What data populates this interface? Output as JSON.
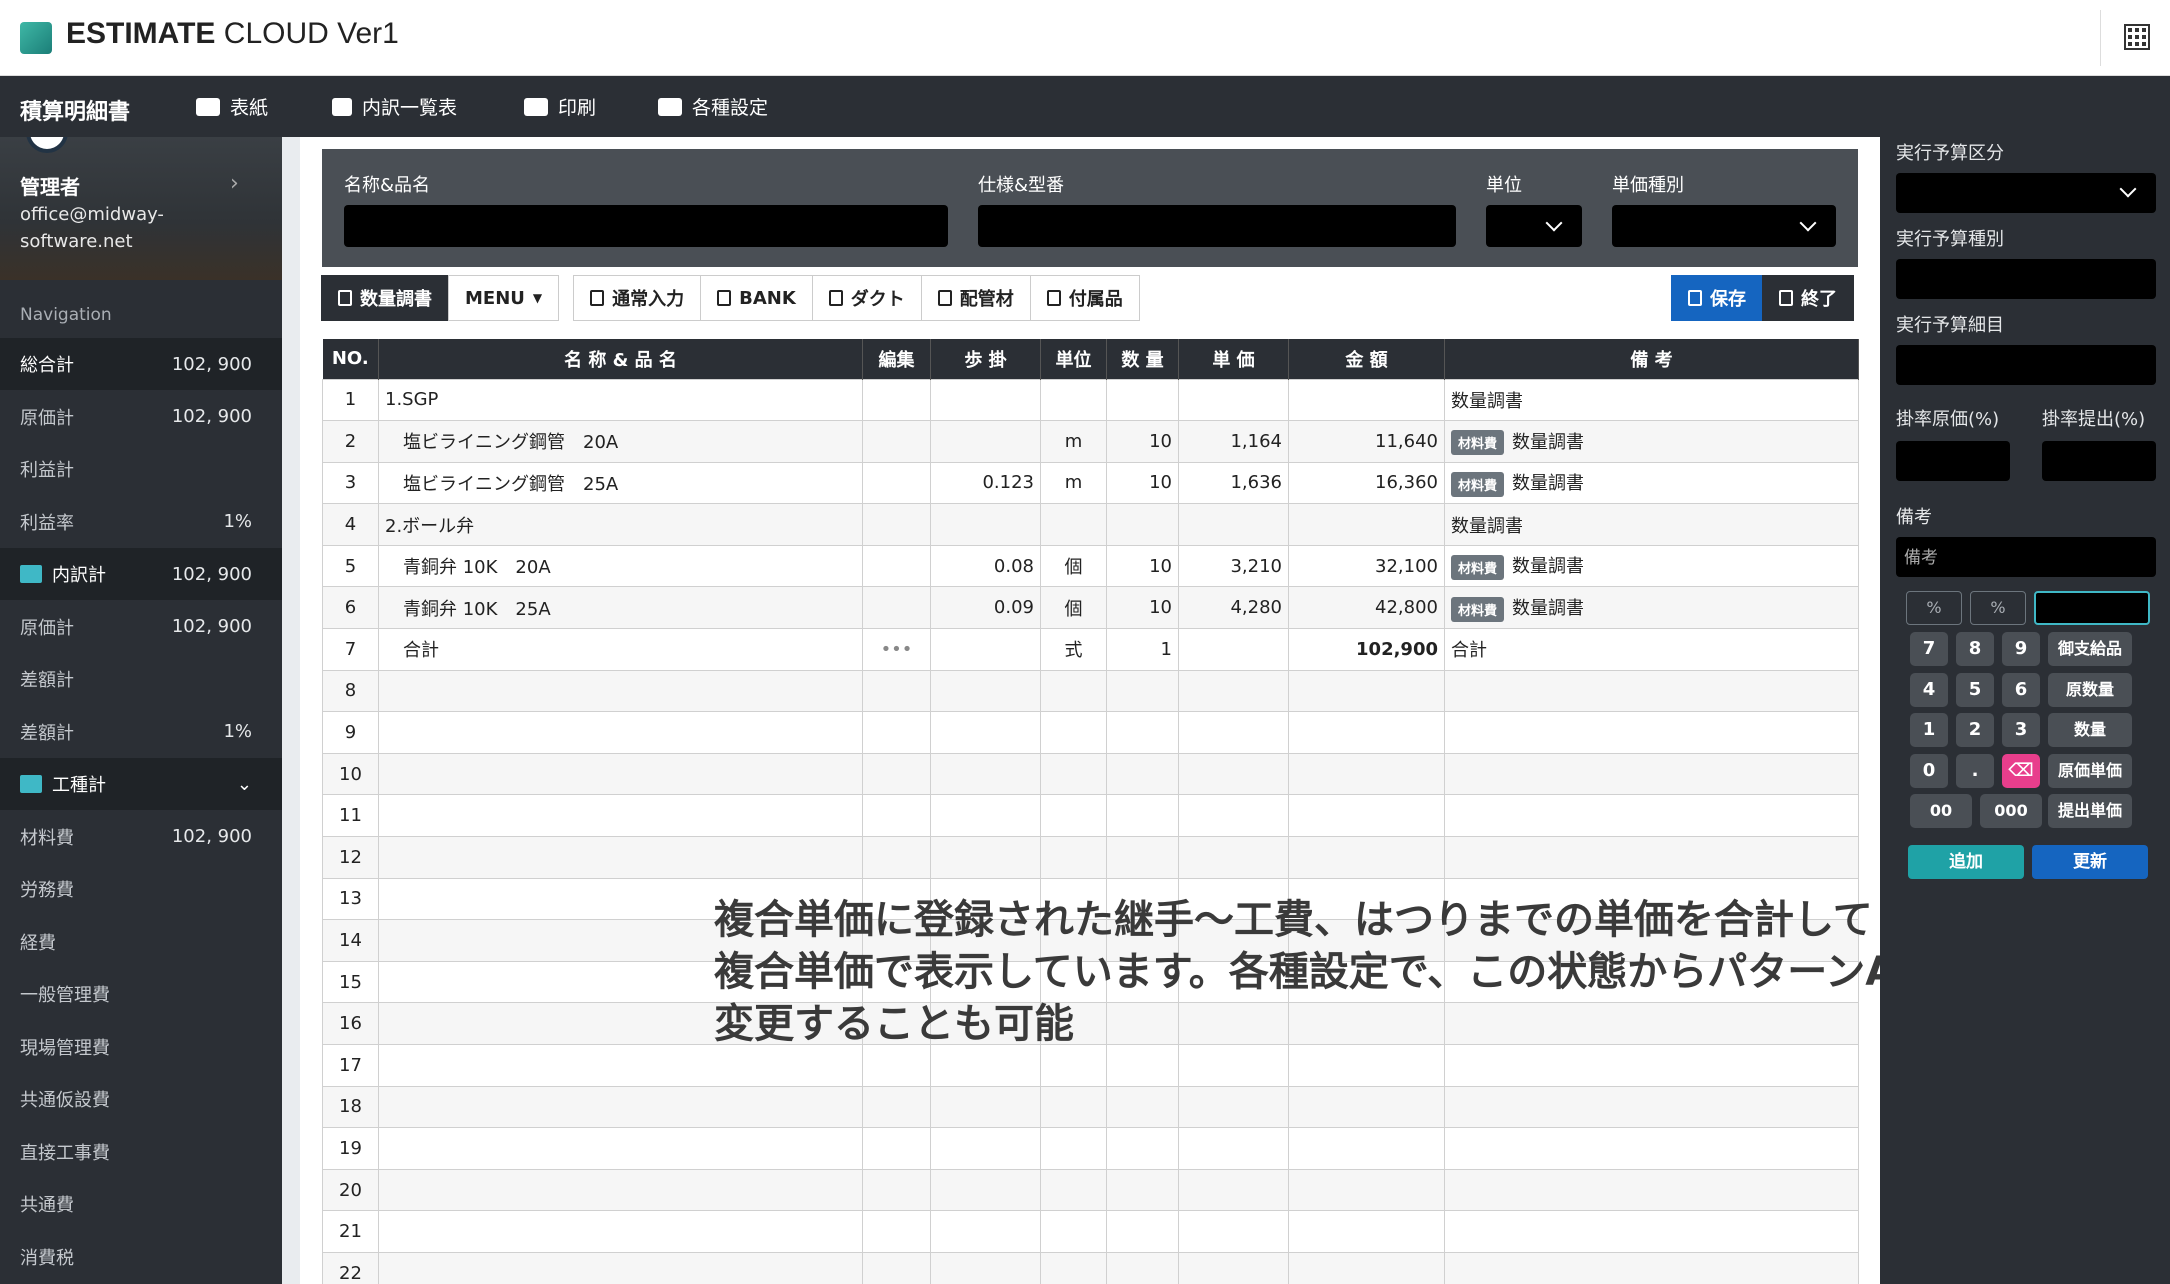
{
  "app": {
    "brand_bold": "ESTIMATE",
    "brand_rest": " CLOUD Ver1"
  },
  "navbar": {
    "title": "積算明細書",
    "items": [
      {
        "label": "表紙",
        "icon": "id-card-icon"
      },
      {
        "label": "内訳一覧表",
        "icon": "list-icon"
      },
      {
        "label": "印刷",
        "icon": "printer-icon"
      },
      {
        "label": "各種設定",
        "icon": "settings-icon"
      }
    ]
  },
  "profile": {
    "name": "管理者",
    "email": "office@midway-software.net"
  },
  "sidebar": {
    "nav_label": "Navigation",
    "rows": [
      {
        "label": "総合計",
        "value": "102, 900"
      },
      {
        "label": "原価計",
        "value": "102, 900"
      },
      {
        "label": "利益計",
        "value": ""
      },
      {
        "label": "利益率",
        "value": "1%"
      },
      {
        "label": "内訳計",
        "value": "102, 900"
      },
      {
        "label": "原価計",
        "value": "102, 900"
      },
      {
        "label": "差額計",
        "value": ""
      },
      {
        "label": "差額計",
        "value": "1%"
      },
      {
        "label": "工種計",
        "value": ""
      },
      {
        "label": "材料費",
        "value": "102, 900"
      },
      {
        "label": "労務費",
        "value": ""
      },
      {
        "label": "経費",
        "value": ""
      },
      {
        "label": "一般管理費",
        "value": ""
      },
      {
        "label": "現場管理費",
        "value": ""
      },
      {
        "label": "共通仮設費",
        "value": ""
      },
      {
        "label": "直接工事費",
        "value": ""
      },
      {
        "label": "共通費",
        "value": ""
      },
      {
        "label": "消費税",
        "value": ""
      }
    ]
  },
  "form": {
    "name_label": "名称&品名",
    "spec_label": "仕様&型番",
    "unit_label": "単位",
    "price_type_label": "単価種別"
  },
  "toolbar": {
    "qty": "数量調書",
    "menu": "MENU",
    "normal": "通常入力",
    "bank": "BANK",
    "duct": "ダクト",
    "pipe": "配管材",
    "accessory": "付属品",
    "save": "保存",
    "exit": "終了"
  },
  "table": {
    "headers": [
      "NO.",
      "名 称 & 品 名",
      "編集",
      "歩 掛",
      "単位",
      "数 量",
      "単 価",
      "金 額",
      "備 考"
    ],
    "rows": [
      {
        "no": "1",
        "name": "1.SGP",
        "edit": "",
        "rate": "",
        "unit": "",
        "qty": "",
        "price": "",
        "amount": "",
        "badge": "",
        "remark": "数量調書"
      },
      {
        "no": "2",
        "name": "塩ビライニング鋼管　20A",
        "edit": "",
        "rate": "",
        "unit": "m",
        "qty": "10",
        "price": "1,164",
        "amount": "11,640",
        "badge": "材料費",
        "remark": "数量調書"
      },
      {
        "no": "3",
        "name": "塩ビライニング鋼管　25A",
        "edit": "",
        "rate": "0.123",
        "unit": "m",
        "qty": "10",
        "price": "1,636",
        "amount": "16,360",
        "badge": "材料費",
        "remark": "数量調書"
      },
      {
        "no": "4",
        "name": "2.ボール弁",
        "edit": "",
        "rate": "",
        "unit": "",
        "qty": "",
        "price": "",
        "amount": "",
        "badge": "",
        "remark": "数量調書"
      },
      {
        "no": "5",
        "name": "青銅弁 10K　20A",
        "edit": "",
        "rate": "0.08",
        "unit": "個",
        "qty": "10",
        "price": "3,210",
        "amount": "32,100",
        "badge": "材料費",
        "remark": "数量調書"
      },
      {
        "no": "6",
        "name": "青銅弁 10K　25A",
        "edit": "",
        "rate": "0.09",
        "unit": "個",
        "qty": "10",
        "price": "4,280",
        "amount": "42,800",
        "badge": "材料費",
        "remark": "数量調書"
      },
      {
        "no": "7",
        "name": "合計",
        "edit": "•••",
        "rate": "",
        "unit": "式",
        "qty": "1",
        "price": "",
        "amount": "102,900",
        "badge": "",
        "remark": "合計"
      },
      {
        "no": "8"
      },
      {
        "no": "9"
      },
      {
        "no": "10"
      },
      {
        "no": "11"
      },
      {
        "no": "12"
      },
      {
        "no": "13"
      },
      {
        "no": "14"
      },
      {
        "no": "15"
      },
      {
        "no": "16"
      },
      {
        "no": "17"
      },
      {
        "no": "18"
      },
      {
        "no": "19"
      },
      {
        "no": "20"
      },
      {
        "no": "21"
      },
      {
        "no": "22"
      }
    ]
  },
  "overlay": {
    "line1": "複合単価に登録された継手～工費、はつりまでの単価を合計して",
    "line2": "複合単価で表示しています。各種設定で、この状態からパターンAに",
    "line3": "変更することも可能"
  },
  "right": {
    "budget_class": "実行予算区分",
    "budget_type": "実行予算種別",
    "budget_detail": "実行予算細目",
    "rate_cost": "掛率原価(%)",
    "rate_submit": "掛率提出(%)",
    "remarks": "備考",
    "remarks_placeholder": "備考",
    "pct1": "%",
    "pct2": "%",
    "keys": [
      "7",
      "8",
      "9",
      "御支給品",
      "4",
      "5",
      "6",
      "原数量",
      "1",
      "2",
      "3",
      "数量",
      "0",
      ".",
      "⌫",
      "原価単価",
      "00",
      "000",
      "提出単価"
    ],
    "add": "追加",
    "update": "更新"
  }
}
